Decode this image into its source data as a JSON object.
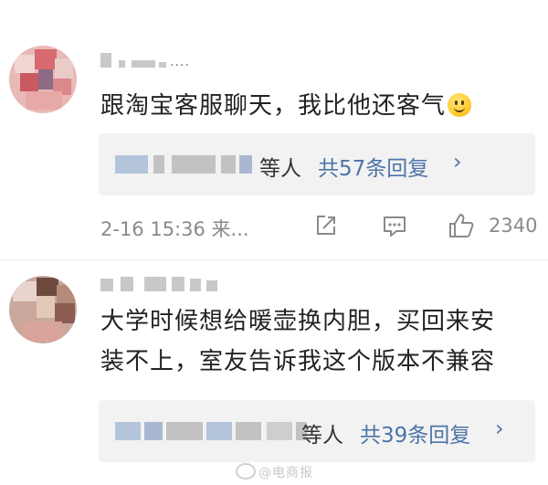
{
  "comments": [
    {
      "text": "跟淘宝客服聊天，我比他还客气",
      "username_suffix": "....",
      "replies": {
        "suffix": "等人",
        "count_label": "共57条回复",
        "arrow": "›"
      },
      "meta": {
        "time": "2-16 15:36 来...",
        "likes": "2340"
      },
      "emoji": "smile-emoji"
    },
    {
      "text_line1": "大学时候想给暖壶换内胆，买回来安",
      "text_line2": "装不上，室友告诉我这个版本不兼容",
      "replies": {
        "suffix": "等人",
        "count_label": "共39条回复",
        "arrow": "›"
      }
    }
  ],
  "watermark": {
    "text": "@电商报"
  },
  "colors": {
    "link": "#4d74a8",
    "text": "#222222",
    "muted": "#8a8a8a",
    "reply_bg": "#f2f2f2"
  }
}
